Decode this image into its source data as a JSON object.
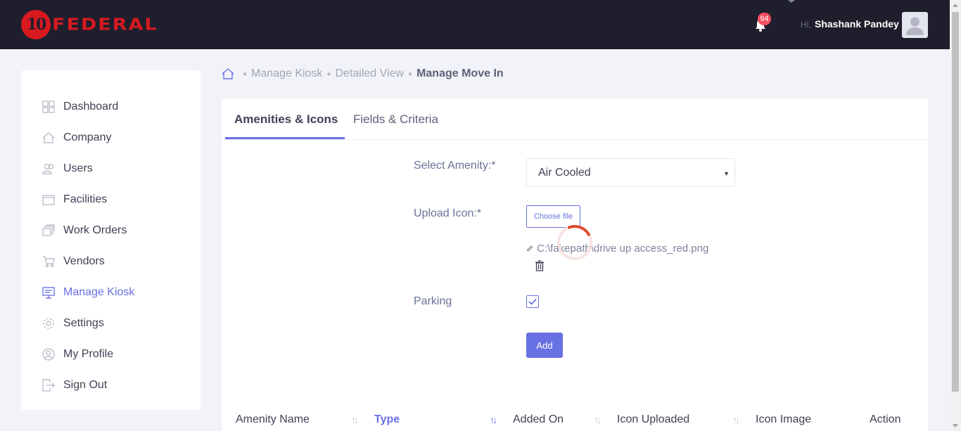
{
  "header": {
    "logo_number": "10",
    "logo_text": "FEDERAL",
    "notification_count": "94",
    "greeting": "Hi,",
    "username": "Shashank Pandey"
  },
  "sidebar": {
    "items": [
      {
        "label": "Dashboard",
        "icon": "dashboard-icon"
      },
      {
        "label": "Company",
        "icon": "home-icon"
      },
      {
        "label": "Users",
        "icon": "users-icon"
      },
      {
        "label": "Facilities",
        "icon": "facilities-icon"
      },
      {
        "label": "Work Orders",
        "icon": "work-orders-icon"
      },
      {
        "label": "Vendors",
        "icon": "cart-icon"
      },
      {
        "label": "Manage Kiosk",
        "icon": "kiosk-icon",
        "active": true
      },
      {
        "label": "Settings",
        "icon": "gear-icon"
      },
      {
        "label": "My Profile",
        "icon": "profile-icon"
      },
      {
        "label": "Sign Out",
        "icon": "sign-out-icon"
      }
    ]
  },
  "breadcrumb": {
    "items": [
      "Manage Kiosk",
      "Detailed View"
    ],
    "current": "Manage Move In"
  },
  "tabs": [
    {
      "label": "Amenities & Icons",
      "active": true
    },
    {
      "label": "Fields & Criteria",
      "active": false
    }
  ],
  "form": {
    "amenity_label": "Select Amenity:*",
    "amenity_value": "Air Cooled",
    "upload_label": "Upload Icon:*",
    "choose_file_label": "Choose file",
    "file_path": "C:\\fakepath\\drive up access_red.png",
    "parking_label": "Parking",
    "parking_checked": true,
    "add_label": "Add"
  },
  "table": {
    "columns": [
      "Amenity Name",
      "Type",
      "Added On",
      "Icon Uploaded",
      "Icon Image",
      "Action"
    ],
    "sorted_column": "Type"
  },
  "colors": {
    "accent": "#6871e3",
    "header_bg": "#1e1e2d",
    "brand_red": "#d71920",
    "badge": "#f64e60"
  }
}
